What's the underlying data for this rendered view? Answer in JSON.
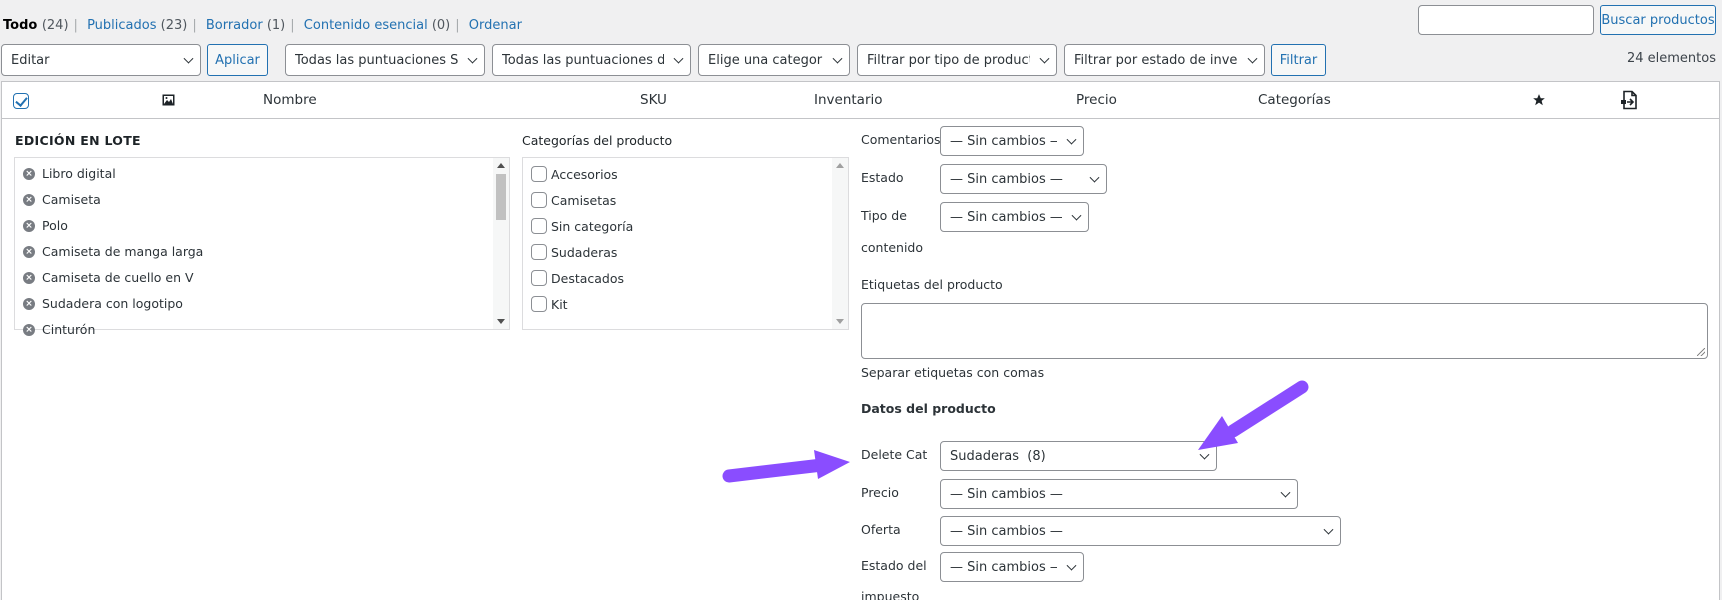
{
  "filters_links": [
    {
      "label": "Todo",
      "count": "(24)"
    },
    {
      "label": "Publicados",
      "count": "(23)"
    },
    {
      "label": "Borrador",
      "count": "(1)"
    },
    {
      "label": "Contenido esencial",
      "count": "(0)"
    },
    {
      "label": "Ordenar",
      "count": ""
    }
  ],
  "search": {
    "value": "",
    "button": "Buscar productos"
  },
  "toolbar": {
    "bulk_action": "Editar",
    "apply": "Aplicar",
    "seo_scores": "Todas las puntuaciones SEO",
    "readability_scores": "Todas las puntuaciones de legibilidad",
    "category": "Elige una categoría",
    "product_type": "Filtrar por tipo de producto",
    "stock_status": "Filtrar por estado de inventario",
    "filter": "Filtrar",
    "item_count": "24 elementos"
  },
  "columns": {
    "name": "Nombre",
    "sku": "SKU",
    "stock": "Inventario",
    "price": "Precio",
    "categories": "Categorías"
  },
  "bulk_edit": {
    "title": "EDICIÓN EN LOTE",
    "products": [
      "Libro digital",
      "Camiseta",
      "Polo",
      "Camiseta de manga larga",
      "Camiseta de cuello en V",
      "Sudadera con logotipo",
      "Cinturón"
    ],
    "categories_title": "Categorías del producto",
    "categories": [
      "Accesorios",
      "Camisetas",
      "Sin categoría",
      "Sudaderas",
      "Destacados",
      "Kit"
    ],
    "comments_label": "Comentarios",
    "comments_value": "— Sin cambios —",
    "status_label": "Estado",
    "status_value": "— Sin cambios —",
    "content_type_label_1": "Tipo de",
    "content_type_label_2": "contenido",
    "content_type_value": "— Sin cambios —",
    "tags_label": "Etiquetas del producto",
    "tags_value": "",
    "tags_help": "Separar etiquetas con comas",
    "product_data_title": "Datos del producto",
    "delete_cat_label": "Delete Cat",
    "delete_cat_value": "Sudaderas  (8)",
    "price_label": "Precio",
    "price_value": "— Sin cambios —",
    "sale_label": "Oferta",
    "sale_value": "— Sin cambios —",
    "tax_status_label_1": "Estado del",
    "tax_status_label_2": "impuesto",
    "tax_status_value": "— Sin cambios —"
  },
  "colors": {
    "accent": "#2271b1",
    "annotation_arrow": "#8a4dff"
  }
}
